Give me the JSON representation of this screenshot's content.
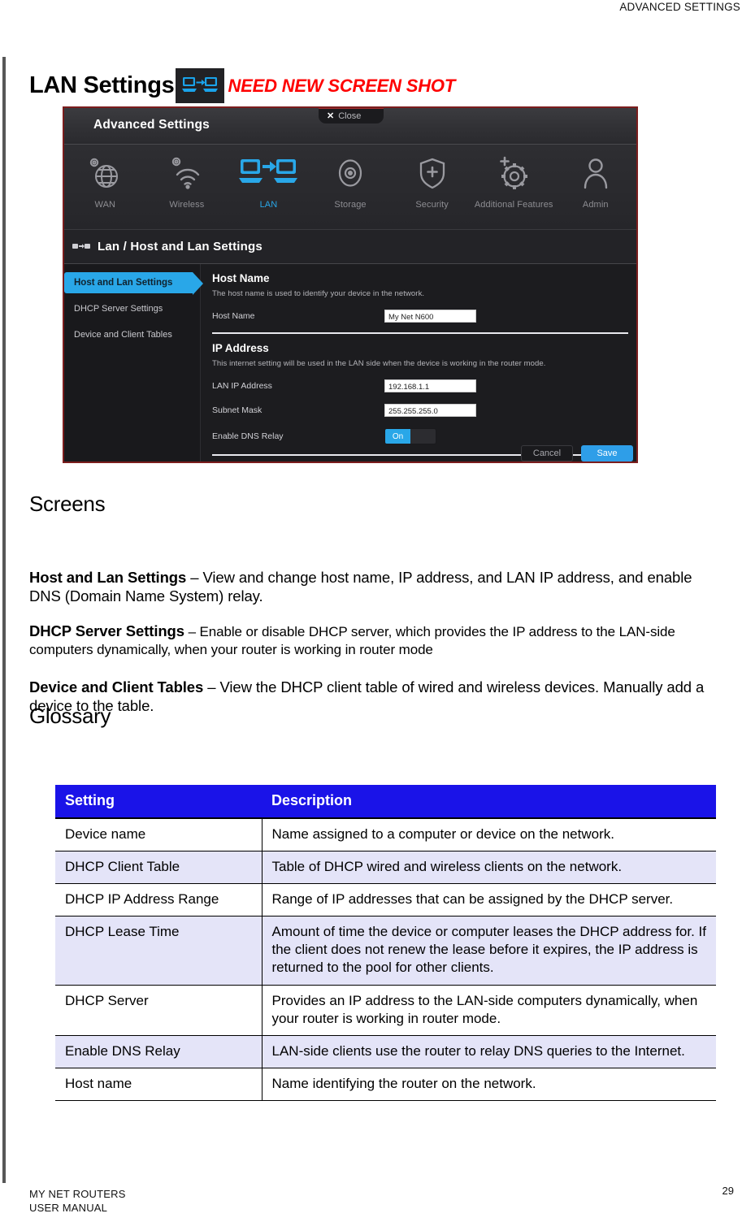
{
  "running_header": "ADVANCED SETTINGS",
  "title": {
    "text": "LAN Settings",
    "icon": "lan-two-computers-arrow-icon",
    "note": "NEED NEW SCREEN SHOT"
  },
  "screenshot": {
    "window_title": "Advanced Settings",
    "close_button": "Close",
    "close_icon": "close-x-icon",
    "nav": [
      {
        "label": "WAN",
        "icon": "globe-gear-icon",
        "active": false
      },
      {
        "label": "Wireless",
        "icon": "wifi-gear-icon",
        "active": false
      },
      {
        "label": "LAN",
        "icon": "lan-two-computers-arrow-icon",
        "active": true
      },
      {
        "label": "Storage",
        "icon": "disc-icon",
        "active": false
      },
      {
        "label": "Security",
        "icon": "shield-plus-icon",
        "active": false
      },
      {
        "label": "Additional Features",
        "icon": "gear-plus-icon",
        "active": false
      },
      {
        "label": "Admin",
        "icon": "person-icon",
        "active": false
      }
    ],
    "breadcrumb": "Lan / Host and Lan Settings",
    "breadcrumb_icon": "lan-small-icon",
    "side_nav": [
      {
        "label": "Host and Lan Settings",
        "selected": true
      },
      {
        "label": "DHCP Server Settings",
        "selected": false
      },
      {
        "label": "Device and Client Tables",
        "selected": false
      }
    ],
    "sections": [
      {
        "heading": "Host Name",
        "description": "The host name is used to identify your device in the network.",
        "fields": [
          {
            "label": "Host Name",
            "value": "My Net N600",
            "type": "text"
          }
        ]
      },
      {
        "heading": "IP Address",
        "description": "This internet setting will be used in the LAN side when the device is working in the router mode.",
        "fields": [
          {
            "label": "LAN IP Address",
            "value": "192.168.1.1",
            "type": "text"
          },
          {
            "label": "Subnet Mask",
            "value": "255.255.255.0",
            "type": "text"
          },
          {
            "label": "Enable DNS Relay",
            "value": "On",
            "type": "toggle",
            "off_label": ""
          }
        ]
      }
    ],
    "buttons": {
      "cancel": "Cancel",
      "save": "Save"
    },
    "colors": {
      "accent": "#29a7e8",
      "window_bg": "#231f20",
      "border": "#7b1d1d"
    }
  },
  "screens": {
    "heading": "Screens",
    "items": [
      {
        "term": "Host and Lan Settings",
        "body": " – View and change host name, IP address, and LAN IP address, and enable DNS (Domain Name System) relay."
      },
      {
        "term": "DHCP Server Settings",
        "body": " – Enable or disable DHCP server, which provides the IP address to the LAN-side computers dynamically, when your router is working in router mode"
      },
      {
        "term": "Device and Client Tables",
        "body": " – View the DHCP client table of wired and wireless devices. Manually add a device to the table."
      }
    ]
  },
  "glossary": {
    "heading": "Glossary",
    "columns": [
      "Setting",
      "Description"
    ],
    "header_color": "#1a13e8",
    "alt_row_color": "#e4e4f8",
    "rows": [
      [
        "Device name",
        "Name assigned to a computer or device on the network."
      ],
      [
        "DHCP Client Table",
        "Table of DHCP wired and wireless clients on the network."
      ],
      [
        "DHCP IP Address Range",
        "Range of IP addresses that can be assigned by the DHCP server."
      ],
      [
        "DHCP Lease Time",
        "Amount of time the device or computer leases the DHCP address for. If the client does not renew the lease before it expires, the IP address is returned to the pool for other clients."
      ],
      [
        "DHCP Server",
        "Provides an IP address to the LAN-side computers dynamically, when your router is working in router mode."
      ],
      [
        "Enable DNS Relay",
        "LAN-side clients use the router to relay DNS queries to the Internet."
      ],
      [
        "Host name",
        "Name identifying the router on the network."
      ]
    ]
  },
  "footer": {
    "line1": "MY NET ROUTERS",
    "line2": "USER MANUAL",
    "page_number": "29"
  }
}
